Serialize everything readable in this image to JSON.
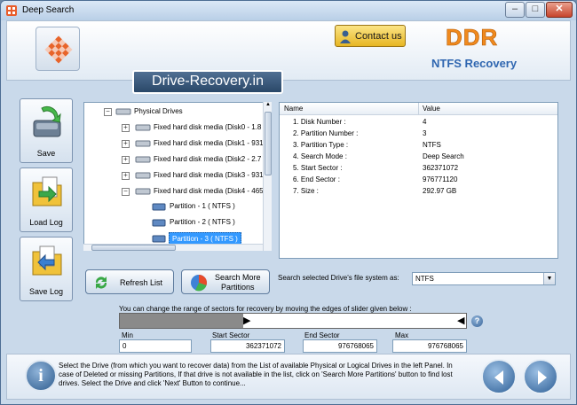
{
  "window": {
    "title": "Deep Search",
    "controls": {
      "minimize": "–",
      "maximize": "□",
      "close": "✕"
    }
  },
  "header": {
    "contact_label": "Contact us",
    "brand": "DDR",
    "product": "NTFS Recovery",
    "banner": "Drive-Recovery.in"
  },
  "sidebar": {
    "save": "Save",
    "load_log": "Load Log",
    "save_log": "Save Log"
  },
  "tree": {
    "root": "Physical Drives",
    "disks": [
      "Fixed hard disk media (Disk0 - 1.8",
      "Fixed hard disk media (Disk1 - 931",
      "Fixed hard disk media (Disk2 - 2.7",
      "Fixed hard disk media (Disk3 - 931",
      "Fixed hard disk media (Disk4 - 465"
    ],
    "partitions": [
      "Partition - 1 ( NTFS )",
      "Partition - 2 ( NTFS )",
      "Partition - 3 ( NTFS )"
    ],
    "selected_partition": 2
  },
  "properties": {
    "col_name": "Name",
    "col_value": "Value",
    "rows": [
      {
        "name": "1. Disk Number :",
        "value": "4"
      },
      {
        "name": "2. Partition Number :",
        "value": "3"
      },
      {
        "name": "3. Partition Type :",
        "value": "NTFS"
      },
      {
        "name": "4. Search Mode :",
        "value": "Deep Search"
      },
      {
        "name": "5. Start Sector :",
        "value": "362371072"
      },
      {
        "name": "6. End Sector :",
        "value": "976771120"
      },
      {
        "name": "7. Size :",
        "value": "292.97 GB"
      }
    ]
  },
  "actions": {
    "refresh": "Refresh List",
    "search_more_1": "Search More",
    "search_more_2": "Partitions"
  },
  "filesystem": {
    "label": "Search selected Drive's file system as:",
    "value": "NTFS"
  },
  "range": {
    "instructions": "You can change the range of sectors for recovery by moving the edges of slider given below :",
    "min_label": "Min",
    "min_value": "0",
    "start_label": "Start Sector",
    "start_value": "362371072",
    "end_label": "End Sector",
    "end_value": "976768065",
    "max_label": "Max",
    "max_value": "976768065",
    "help": "?"
  },
  "footer": {
    "info_glyph": "i",
    "help_text": "Select the Drive (from which you want to recover data) from the List of available Physical or Logical Drives in the left Panel. In case of Deleted or missing Partitions, If that drive is not available in the list, click on 'Search More Partitions' button to find lost drives. Select the Drive and click 'Next' Button to continue..."
  },
  "colors": {
    "window_bg": "#c9d9ea",
    "brand_orange": "#f08a1e",
    "product_blue": "#2f66b0",
    "selection": "#3399ff"
  }
}
